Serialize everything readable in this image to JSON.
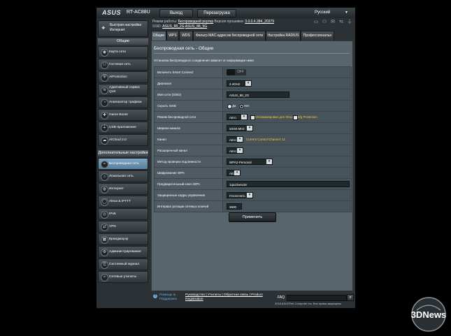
{
  "header": {
    "brand": "ASUS",
    "model": "RT-AC88U",
    "logout_label": "Выход",
    "reboot_label": "Перезагрузка",
    "language": "Русский"
  },
  "info": {
    "mode_label": "Режим работы:",
    "mode_value": "Беспроводной роутер",
    "firmware_label": "Версия прошивки:",
    "firmware_value": "3.0.0.4.384_20379",
    "ssid_label": "SSID:",
    "ssid_1": "ASUS_88_2G",
    "ssid_2": "ASUS_88_5G"
  },
  "sidebar": {
    "quick_setup": "Быстрая настройка Интернет",
    "general_header": "Общие",
    "general_items": [
      {
        "label": "Карта сети",
        "icon": "network-map-icon"
      },
      {
        "label": "Гостевая сеть",
        "icon": "guest-network-icon"
      },
      {
        "label": "AiProtection",
        "icon": "shield-icon"
      },
      {
        "label": "Адаптивный сервис QoS",
        "icon": "qos-icon"
      },
      {
        "label": "Анализатор трафика",
        "icon": "traffic-analyzer-icon"
      },
      {
        "label": "Game Boost",
        "icon": "gamepad-icon"
      },
      {
        "label": "USB-приложение",
        "icon": "usb-icon"
      },
      {
        "label": "AiCloud 2.0",
        "icon": "cloud-icon"
      }
    ],
    "advanced_header": "Дополнительные настройки",
    "advanced_items": [
      {
        "label": "Беспроводная сеть",
        "icon": "wireless-icon"
      },
      {
        "label": "Локальная сеть",
        "icon": "lan-icon"
      },
      {
        "label": "Интернет",
        "icon": "globe-icon"
      },
      {
        "label": "Alexa & IFTTT",
        "icon": "alexa-icon"
      },
      {
        "label": "IPv6",
        "icon": "ipv6-icon"
      },
      {
        "label": "VPN",
        "icon": "vpn-icon"
      },
      {
        "label": "Брандмауэр",
        "icon": "firewall-icon"
      },
      {
        "label": "Администрирование",
        "icon": "admin-icon"
      },
      {
        "label": "Системный журнал",
        "icon": "log-icon"
      },
      {
        "label": "Сетевые утилиты",
        "icon": "tools-icon"
      }
    ]
  },
  "tabs": [
    "Общие",
    "WPS",
    "WDS",
    "Фильтр MAC-адресов беспроводной сети",
    "Настройка RADIUS",
    "Профессиональн"
  ],
  "panel": {
    "title": "Беспроводная сеть - Общие",
    "description": "Установка беспроводного соединения зависит от информации ниже.",
    "rows": {
      "smart_connect": {
        "label": "Включить Smart Connect",
        "value": "OFF"
      },
      "band": {
        "label": "Диапазон",
        "value": "2.4GHz"
      },
      "ssid": {
        "label": "Имя сети (SSID)",
        "value": "ASUS_88_2G"
      },
      "hide_ssid": {
        "label": "Скрыть SSID",
        "yes": "Да",
        "no": "Нет"
      },
      "mode": {
        "label": "Режим беспроводной сети",
        "value": "Авто",
        "opt1": "Оптимизирован для Xbox",
        "opt2": "b/g Protection"
      },
      "width": {
        "label": "Ширина канала",
        "value": "20/40 MHz"
      },
      "channel": {
        "label": "Канал",
        "value": "Авто",
        "current": "Current Control Channel: 11"
      },
      "ext_channel": {
        "label": "Расширенный канал",
        "value": "Авто"
      },
      "auth": {
        "label": "Метод проверки подлинности",
        "value": "WPA2-Personal"
      },
      "encryption": {
        "label": "Шифрование WPA",
        "value": "AES"
      },
      "psk": {
        "label": "Предварительный ключ WPA",
        "value": "1qaz2wsx3e"
      },
      "pmf": {
        "label": "Защищенные кадры управления",
        "value": "Отключить"
      },
      "rekey": {
        "label": "Интервал ротации сетевых ключей",
        "value": "3600"
      }
    },
    "apply_label": "Применить"
  },
  "footer": {
    "help": "Помощь & Поддержка",
    "links": "Руководство | Утилиты | Обратная связь | Product Registration",
    "faq": "FAQ",
    "copyright": "2018 ASUSTeK Computer Inc. Все права защищены."
  },
  "watermark": "3DNews"
}
